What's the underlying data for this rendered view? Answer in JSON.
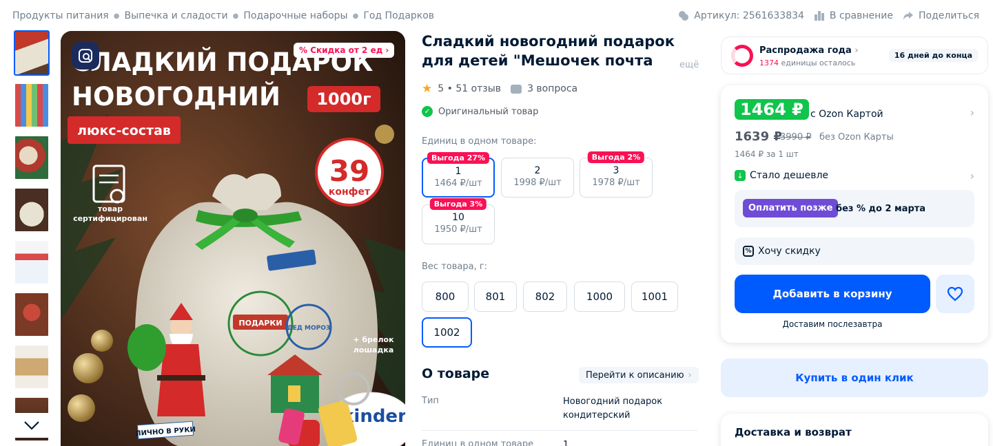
{
  "breadcrumbs": [
    "Продукты питания",
    "Выпечка и сладости",
    "Подарочные наборы",
    "Год Подарков"
  ],
  "topbar": {
    "article": "Артикул: 2561633834",
    "compare": "В сравнение",
    "share": "Поделиться"
  },
  "product": {
    "title": "Сладкий новогодний подарок для детей \"Мешочек почта Де",
    "more": "ещё",
    "rating": "5 • 51 отзыв",
    "questions": "3 вопроса",
    "original": "Оригинальный товар"
  },
  "image_text": {
    "discount_badge": "% Скидка от 2 ед",
    "headline1": "СЛАДКИЙ ПОДАРОК",
    "headline2": "НОВОГОДНИЙ",
    "weight_tag": "1000г",
    "lux": "люкс-состав",
    "count_num": "39",
    "count_word": "конфет",
    "cert1": "товар",
    "cert2": "сертифицирован",
    "keychain1": "+ брелок",
    "keychain2": "лошадка",
    "bag_stamp1": "ПОДАРКИ",
    "bag_stamp2": "ДЕД МОРОЗ",
    "bag_note": "ЛИЧНО В РУКИ",
    "brand": "kinder"
  },
  "units": {
    "label": "Единиц в одном товаре:",
    "options": [
      {
        "qty": "1",
        "price": "1464 ₽/шт",
        "badge": "Выгода 27%",
        "active": true
      },
      {
        "qty": "2",
        "price": "1998 ₽/шт",
        "badge": "",
        "active": false
      },
      {
        "qty": "3",
        "price": "1978 ₽/шт",
        "badge": "Выгода 2%",
        "active": false
      },
      {
        "qty": "10",
        "price": "1950 ₽/шт",
        "badge": "Выгода 3%",
        "active": false
      }
    ]
  },
  "weights": {
    "label": "Вес товара, г:",
    "options": [
      "800",
      "801",
      "802",
      "1000",
      "1001",
      "1002"
    ],
    "selected": "1002"
  },
  "about": {
    "heading": "О товаре",
    "goto": "Перейти к описанию",
    "specs": [
      {
        "key": "Тип",
        "value": "Новогодний подарок кондитерский"
      },
      {
        "key": "Единиц в одном товаре",
        "value": "1"
      }
    ]
  },
  "sale": {
    "title": "Распродажа года",
    "count": "1374",
    "count_suffix": " единицы осталось",
    "days": "16 дней до конца"
  },
  "price": {
    "card": "1464 ₽",
    "card_label": "с Ozon Картой",
    "regular": "1639 ₽",
    "old": "3990 ₽",
    "regular_label": "без Ozon Карты",
    "per_unit": "1464 ₽ за 1 шт",
    "cheaper": "Стало дешевле"
  },
  "paylater": {
    "button": "Оплатить позже",
    "text": "без % до 2 марта"
  },
  "want_discount": "Хочу скидку",
  "add_to_cart": "Добавить в корзину",
  "delivery_note": "Доставим послезавтра",
  "one_click": "Купить в один клик",
  "delivery_heading": "Доставка и возврат",
  "colors": {
    "accent": "#005bff",
    "green": "#10c44c",
    "pink": "#f91155",
    "purple": "#6f4cd6"
  }
}
